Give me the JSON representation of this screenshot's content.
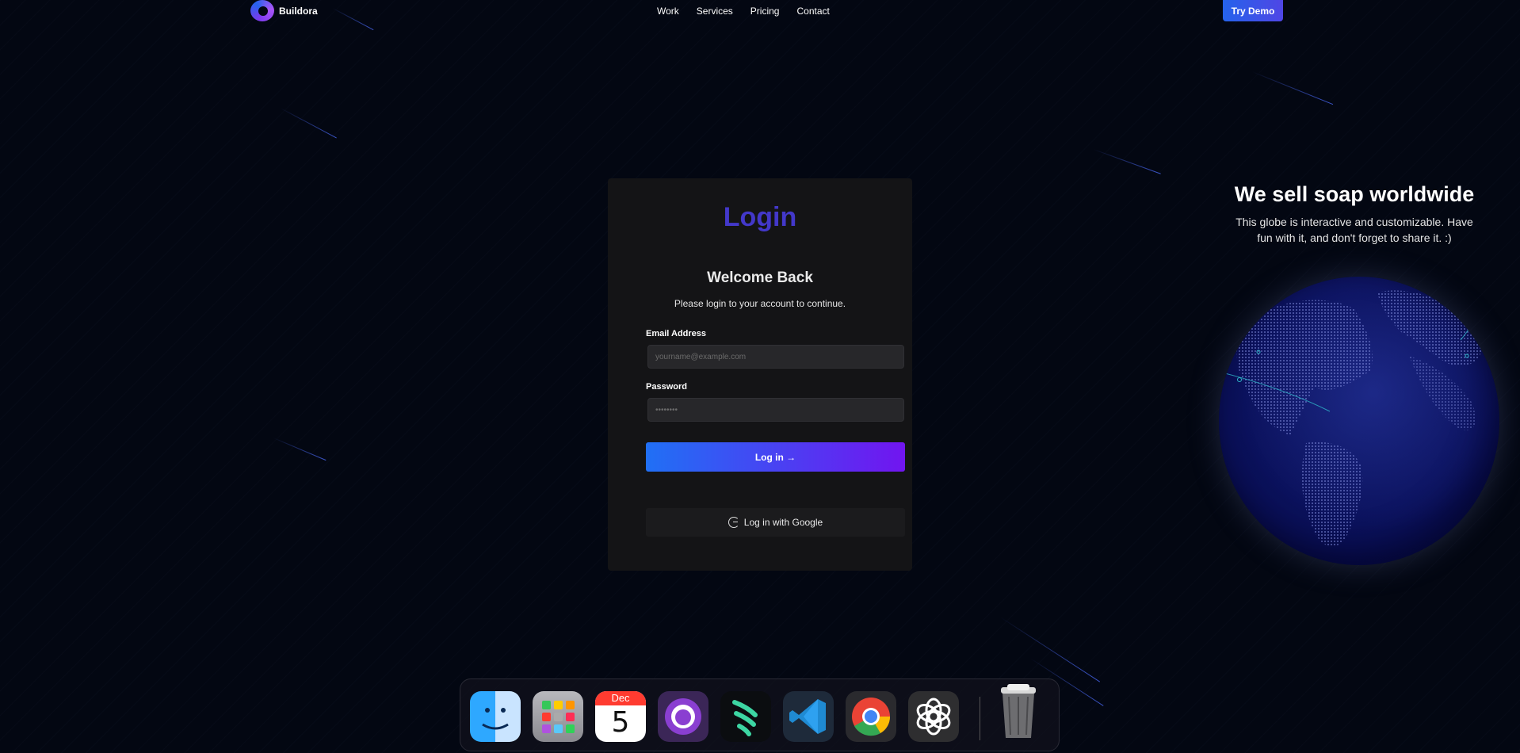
{
  "brand": {
    "name": "Buildora"
  },
  "nav": {
    "links": [
      "Work",
      "Services",
      "Pricing",
      "Contact"
    ],
    "cta": "Try Demo"
  },
  "login": {
    "title": "Login",
    "welcome": "Welcome Back",
    "subtitle": "Please login to your account to continue.",
    "email_label": "Email Address",
    "email_placeholder": "yourname@example.com",
    "password_label": "Password",
    "password_placeholder": "••••••••",
    "submit_label": "Log in →",
    "google_label": "Log in with Google"
  },
  "globe": {
    "title": "We sell soap worldwide",
    "subtitle": "This globe is interactive and customizable. Have fun with it, and don't forget to share it. :)"
  },
  "dock": {
    "apps": [
      "Finder",
      "Launchpad",
      "Calendar",
      "GitHub Desktop",
      "Cursor",
      "Visual Studio Code",
      "Google Chrome",
      "ChatGPT",
      "Trash"
    ],
    "calendar_month": "Dec",
    "calendar_day": "5"
  },
  "colors": {
    "background": "#030712",
    "accent": "#4338ca",
    "button_start": "#2070f5",
    "button_end": "#7115f0"
  }
}
